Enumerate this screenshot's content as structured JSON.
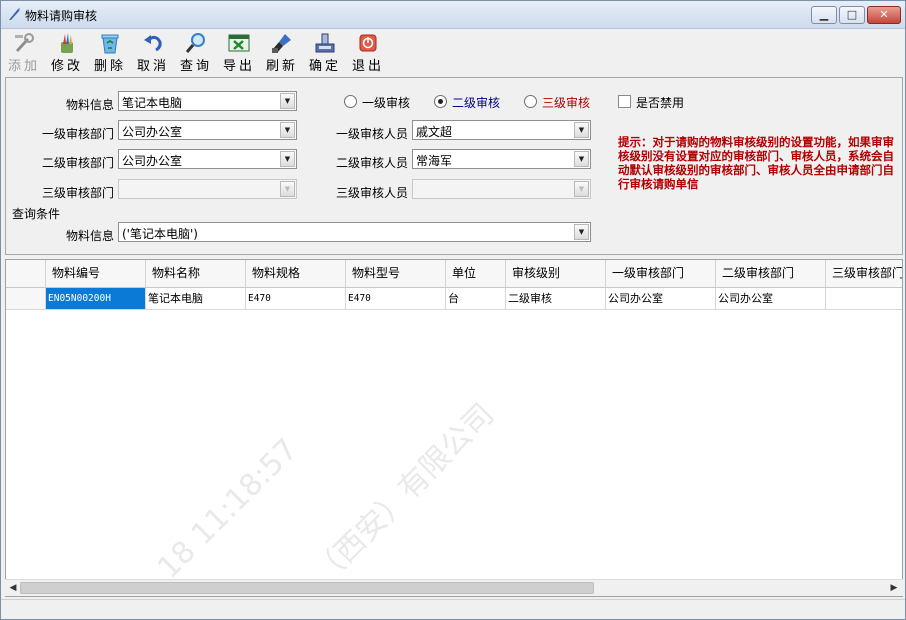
{
  "window": {
    "title": "物料请购审核",
    "min_label": "▁",
    "max_label": "□",
    "close_label": "✕"
  },
  "toolbar": {
    "items": [
      {
        "label": "添加",
        "icon": "add-tools-icon",
        "enabled": false
      },
      {
        "label": "修改",
        "icon": "edit-pencils-icon",
        "enabled": true
      },
      {
        "label": "删除",
        "icon": "recycle-bin-icon",
        "enabled": true
      },
      {
        "label": "取消",
        "icon": "undo-arrow-icon",
        "enabled": true
      },
      {
        "label": "查询",
        "icon": "magnifier-icon",
        "enabled": true
      },
      {
        "label": "导出",
        "icon": "excel-export-icon",
        "enabled": true
      },
      {
        "label": "刷新",
        "icon": "paint-brush-icon",
        "enabled": true
      },
      {
        "label": "确定",
        "icon": "save-disk-icon",
        "enabled": true
      },
      {
        "label": "退出",
        "icon": "power-exit-icon",
        "enabled": true
      }
    ]
  },
  "form": {
    "material_info": {
      "label": "物料信息",
      "value": "笔记本电脑"
    },
    "level1_dept": {
      "label": "一级审核部门",
      "value": "公司办公室"
    },
    "level2_dept": {
      "label": "二级审核部门",
      "value": "公司办公室"
    },
    "level3_dept": {
      "label": "三级审核部门",
      "value": ""
    },
    "level_radios": [
      {
        "label": "一级审核",
        "checked": false,
        "color": "#000000"
      },
      {
        "label": "二级审核",
        "checked": true,
        "color": "#00008b"
      },
      {
        "label": "三级审核",
        "checked": false,
        "color": "#b00000"
      }
    ],
    "disabled_check": {
      "label": "是否禁用",
      "checked": false
    },
    "level1_person": {
      "label": "一级审核人员",
      "value": "戚文超"
    },
    "level2_person": {
      "label": "二级审核人员",
      "value": "常海军"
    },
    "level3_person": {
      "label": "三级审核人员",
      "value": ""
    },
    "query_section": {
      "label": "查询条件"
    },
    "query_material": {
      "label": "物料信息",
      "value": "('笔记本电脑')"
    },
    "hint": "提示：对于请购的物料审核级别的设置功能，如果审审核级别没有设置对应的审核部门、审核人员，系统会自动默认审核级别的审核部门、审核人员全由申请部门自行审核请购单信"
  },
  "grid": {
    "columns": [
      "物料编号",
      "物料名称",
      "物料规格",
      "物料型号",
      "单位",
      "审核级别",
      "一级审核部门",
      "二级审核部门",
      "三级审核部门"
    ],
    "rows": [
      [
        "EN05N00200H",
        "笔记本电脑",
        "E470",
        "E470",
        "台",
        "二级审核",
        "公司办公室",
        "公司办公室",
        ""
      ]
    ]
  },
  "scrollbar": {
    "left_arrow": "◀",
    "right_arrow": "▶"
  },
  "watermark": "（西安）有限公司",
  "watermark_time": "18 11:18:57",
  "colors": {
    "hint": "#b00000",
    "selection": "#0a7ad6",
    "title_bar": "#cddbec"
  }
}
